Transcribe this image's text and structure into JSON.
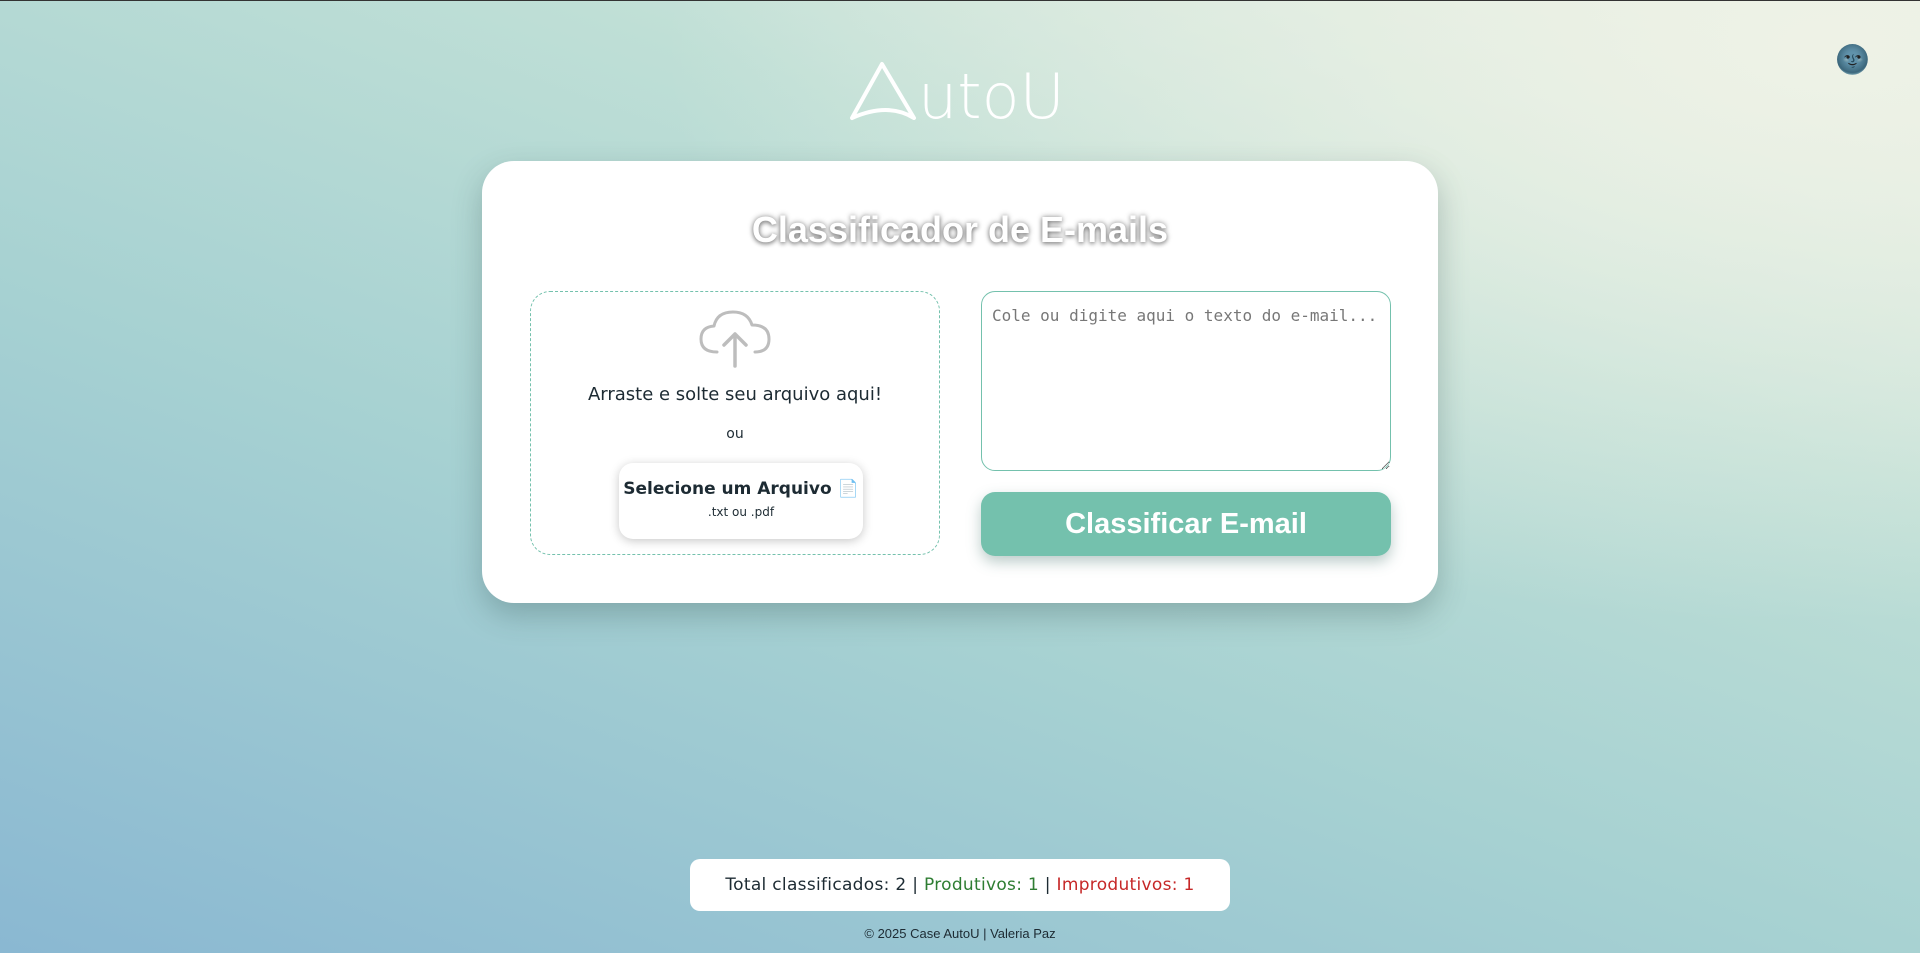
{
  "brand": {
    "logo_text": "AutoU"
  },
  "header": {
    "theme_toggle_icon": "moon-face-icon",
    "theme_toggle_glyph": "🌚"
  },
  "card": {
    "title": "Classificador de E-mails",
    "dropzone": {
      "icon": "cloud-upload-icon",
      "drag_text": "Arraste e solte seu arquivo aqui!",
      "or_text": "ou",
      "select_button_label": "Selecione um Arquivo 📄",
      "select_button_hint": ".txt ou .pdf"
    },
    "email_input": {
      "value": "",
      "placeholder": "Cole ou digite aqui o texto do e-mail..."
    },
    "classify_button_label": "Classificar E-mail"
  },
  "stats": {
    "total_label": "Total classificados: 2",
    "separator": "|",
    "productive_label": "Produtivos: 1",
    "unproductive_label": "Improdutivos: 1"
  },
  "footer": {
    "text": "© 2025 Case AutoU | Valeria Paz"
  },
  "colors": {
    "accent": "#74c1ad",
    "productive": "#2e7d32",
    "unproductive": "#c62828"
  }
}
